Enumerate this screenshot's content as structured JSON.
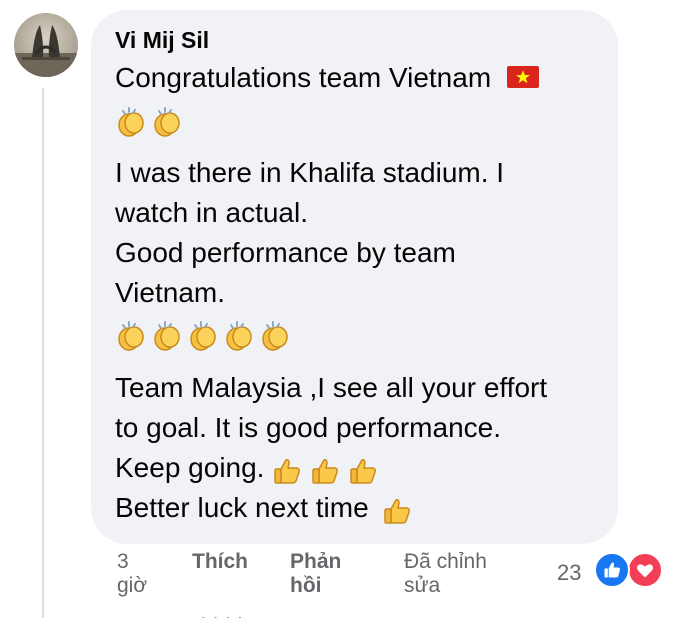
{
  "comment": {
    "author": "Vi Mij Sil",
    "lines": [
      "Congratulations team Vietnam",
      "I was there in Khalifa stadium. I",
      "watch in actual.",
      "Good performance by team",
      "Vietnam.",
      "Team Malaysia ,I see all your effort",
      "to goal. It is good performance.",
      "Keep going.",
      "Better luck next time"
    ],
    "emoji": {
      "flag": "vietnam-flag-icon",
      "clap": "clapping-hands-icon",
      "thumb": "thumbs-up-icon"
    }
  },
  "actions": {
    "time_line1": "3",
    "time_line2": "giờ",
    "like_label": "Thích",
    "reply_line1": "Phản",
    "reply_line2": "hồi",
    "edited_line1": "Đã chỉnh",
    "edited_line2": "sửa",
    "reaction_count": "23",
    "reaction_icons": [
      "like-icon",
      "love-icon"
    ]
  },
  "colors": {
    "bubble": "#f0f2f5",
    "meta_text": "#65676b",
    "like_blue": "#1877f2",
    "love_red": "#f33e58"
  }
}
